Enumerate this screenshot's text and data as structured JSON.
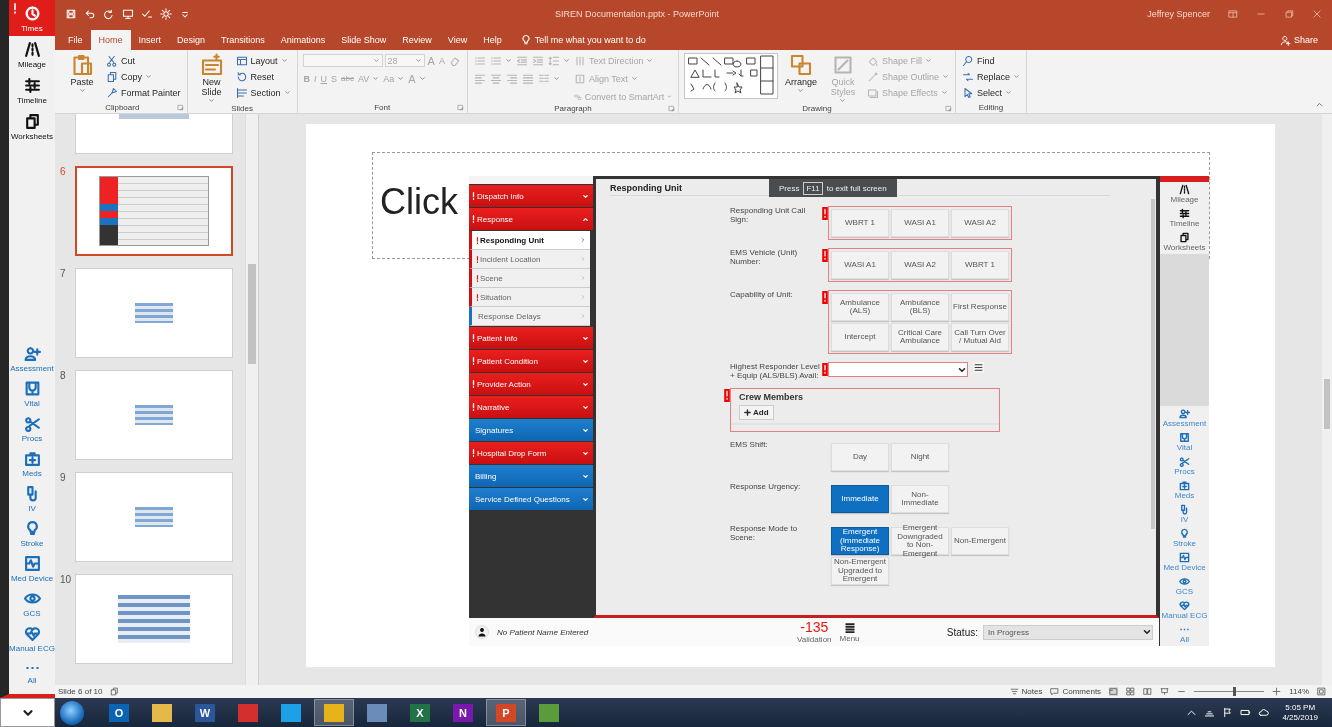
{
  "rail": {
    "top": [
      {
        "label": "Times",
        "kind": "clock",
        "selected": true,
        "alert": true
      },
      {
        "label": "Mileage",
        "kind": "road",
        "selected": false,
        "alert": false
      },
      {
        "label": "Timeline",
        "kind": "sliders",
        "selected": false,
        "alert": false
      },
      {
        "label": "Worksheets",
        "kind": "copy",
        "selected": false,
        "alert": false
      }
    ],
    "bottom": [
      {
        "label": "Assessment",
        "kind": "personadd"
      },
      {
        "label": "Vital",
        "kind": "stethoscope"
      },
      {
        "label": "Procs",
        "kind": "scissors"
      },
      {
        "label": "Meds",
        "kind": "medkit"
      },
      {
        "label": "IV",
        "kind": "iv"
      },
      {
        "label": "Stroke",
        "kind": "bulb"
      },
      {
        "label": "Med Device",
        "kind": "monitor"
      },
      {
        "label": "GCS",
        "kind": "eye"
      },
      {
        "label": "Manual ECG",
        "kind": "heart"
      },
      {
        "label": "All",
        "kind": "dots"
      }
    ]
  },
  "window": {
    "title": "SIREN Documentation.pptx  -  PowerPoint",
    "user": "Jeffrey Spencer",
    "share": "Share",
    "tell_me": "Tell me what you want to do"
  },
  "quick_access": [
    {
      "kind": "save"
    },
    {
      "kind": "undo"
    },
    {
      "kind": "redo"
    },
    {
      "kind": "present"
    },
    {
      "kind": "spell"
    },
    {
      "kind": "sun"
    },
    {
      "kind": "more"
    }
  ],
  "ribbon_tabs": [
    {
      "label": "File",
      "selected": false
    },
    {
      "label": "Home",
      "selected": true
    },
    {
      "label": "Insert",
      "selected": false
    },
    {
      "label": "Design",
      "selected": false
    },
    {
      "label": "Transitions",
      "selected": false
    },
    {
      "label": "Animations",
      "selected": false
    },
    {
      "label": "Slide Show",
      "selected": false
    },
    {
      "label": "Review",
      "selected": false
    },
    {
      "label": "View",
      "selected": false
    },
    {
      "label": "Help",
      "selected": false
    }
  ],
  "ribbon_groups": [
    {
      "label": "Clipboard",
      "dialog": true,
      "columns": [
        [
          {
            "kind": "paste",
            "label": "Paste",
            "dropdown": true,
            "disabled": false
          }
        ],
        [
          {
            "kind": "cut",
            "label": "Cut",
            "dropdown": false,
            "disabled": false
          },
          {
            "kind": "copy",
            "label": "Copy",
            "dropdown": true,
            "disabled": false
          },
          {
            "kind": "brush",
            "label": "Format Painter",
            "dropdown": false,
            "disabled": false
          }
        ]
      ]
    },
    {
      "label": "Slides",
      "dialog": false,
      "columns": [
        [
          {
            "kind": "newslide",
            "label": "New Slide",
            "dropdown": true,
            "disabled": false
          }
        ],
        [
          {
            "kind": "layout",
            "label": "Layout",
            "dropdown": true,
            "disabled": false
          },
          {
            "kind": "reset",
            "label": "Reset",
            "dropdown": false,
            "disabled": false
          },
          {
            "kind": "section",
            "label": "Section",
            "dropdown": true,
            "disabled": false
          }
        ]
      ]
    },
    {
      "label": "Font",
      "dialog": true,
      "lines": [
        [
          {
            "kind": "field",
            "disabled": true
          },
          {
            "kind": "field",
            "value": "28",
            "disabled": true
          },
          {
            "kind": "grow",
            "label": "A",
            "disabled": true
          },
          {
            "kind": "shrink",
            "label": "A",
            "disabled": true
          },
          {
            "kind": "eraser",
            "disabled": true
          }
        ],
        [
          {
            "kind": "bold",
            "label": "B",
            "disabled": true
          },
          {
            "kind": "italic",
            "label": "I",
            "disabled": true
          },
          {
            "kind": "underline",
            "label": "U",
            "disabled": true
          },
          {
            "kind": "shadow",
            "label": "S",
            "disabled": true
          },
          {
            "kind": "strike",
            "label": "abc",
            "disabled": true
          },
          {
            "kind": "spacing",
            "label": "AV",
            "dropdown": true,
            "disabled": true
          },
          {
            "kind": "case",
            "label": "Aa",
            "dropdown": true,
            "disabled": true
          },
          {
            "kind": "fontcolor",
            "label": "A",
            "dropdown": true,
            "disabled": true
          }
        ]
      ]
    },
    {
      "label": "Paragraph",
      "dialog": true,
      "lines": [
        [
          {
            "kind": "bullets",
            "disabled": true
          },
          {
            "kind": "numbering",
            "dropdown": true,
            "disabled": true
          },
          {
            "kind": "outdent",
            "disabled": true
          },
          {
            "kind": "indent",
            "disabled": true
          },
          {
            "kind": "linespacing",
            "dropdown": true,
            "disabled": true
          },
          {
            "kind": "textdir",
            "label": "Text Direction",
            "dropdown": true,
            "disabled": true
          }
        ],
        [
          {
            "kind": "alignleft",
            "disabled": true
          },
          {
            "kind": "aligncenter",
            "disabled": true
          },
          {
            "kind": "alignright",
            "disabled": true
          },
          {
            "kind": "justify",
            "disabled": true
          },
          {
            "kind": "columns",
            "dropdown": true,
            "disabled": true
          },
          {
            "kind": "aligntext",
            "label": "Align Text",
            "dropdown": true,
            "disabled": true
          }
        ],
        [
          {
            "kind": "smartart",
            "label": "Convert to SmartArt",
            "dropdown": true,
            "disabled": true
          }
        ]
      ]
    },
    {
      "label": "Drawing",
      "dialog": true,
      "columns": [
        [
          {
            "kind": "gallery",
            "disabled": false
          }
        ],
        [
          {
            "kind": "arrange",
            "label": "Arrange",
            "dropdown": true,
            "disabled": false
          }
        ],
        [
          {
            "kind": "quickstyles",
            "label": "Quick Styles",
            "dropdown": true,
            "disabled": true
          }
        ],
        [
          {
            "kind": "fill",
            "label": "Shape Fill",
            "dropdown": true,
            "disabled": true
          },
          {
            "kind": "outline",
            "label": "Shape Outline",
            "dropdown": true,
            "disabled": true
          },
          {
            "kind": "effects",
            "label": "Shape Effects",
            "dropdown": true,
            "disabled": true
          }
        ]
      ]
    },
    {
      "label": "Editing",
      "dialog": false,
      "columns": [
        [
          {
            "kind": "search",
            "label": "Find",
            "dropdown": false,
            "disabled": false
          },
          {
            "kind": "replace",
            "label": "Replace",
            "dropdown": true,
            "disabled": false
          },
          {
            "kind": "cursor",
            "label": "Select",
            "dropdown": true,
            "disabled": false
          }
        ]
      ]
    }
  ],
  "thumbnails": [
    {
      "kind": "small-image",
      "selected": false
    },
    {
      "number": "6",
      "kind": "app",
      "selected": true
    },
    {
      "number": "7",
      "kind": "table",
      "selected": false
    },
    {
      "number": "8",
      "kind": "table",
      "selected": false
    },
    {
      "number": "9",
      "kind": "table",
      "selected": false
    },
    {
      "number": "10",
      "kind": "large-table",
      "selected": false
    }
  ],
  "slide": {
    "placeholder": "Click",
    "siren": {
      "nav": [
        {
          "label": "Dispatch Info",
          "required": true,
          "expanded": false
        },
        {
          "label": "Response",
          "required": true,
          "expanded": true,
          "children": [
            {
              "label": "Responding Unit",
              "required": true,
              "selected": true
            },
            {
              "label": "Incident Location",
              "required": true,
              "selected": false
            },
            {
              "label": "Scene",
              "required": true,
              "selected": false
            },
            {
              "label": "Situation",
              "required": true,
              "selected": false
            },
            {
              "label": "Response Delays",
              "required": false,
              "selected": false
            }
          ]
        },
        {
          "label": "Patient Info",
          "required": true,
          "expanded": false
        },
        {
          "label": "Patient Condition",
          "required": true,
          "expanded": false
        },
        {
          "label": "Provider Action",
          "required": true,
          "expanded": false
        },
        {
          "label": "Narrative",
          "required": true,
          "expanded": false
        },
        {
          "label": "Signatures",
          "required": false,
          "expanded": false
        },
        {
          "label": "Hospital Drop Form",
          "required": true,
          "expanded": false
        },
        {
          "label": "Billing",
          "required": false,
          "expanded": false
        },
        {
          "label": "Service Defined Questions",
          "required": false,
          "expanded": false
        }
      ],
      "heading": "Responding Unit",
      "tooltip": {
        "before": "Press",
        "key": "F11",
        "after": "to exit full screen"
      },
      "fields": [
        {
          "kind": "choice",
          "label": "Responding Unit Call Sign:",
          "required": true,
          "options": [
            {
              "label": "WBRT 1",
              "selected": false
            },
            {
              "label": "WASI A1",
              "selected": false
            },
            {
              "label": "WASI A2",
              "selected": false
            }
          ]
        },
        {
          "kind": "choice",
          "label": "EMS Vehicle (Unit) Number:",
          "required": true,
          "options": [
            {
              "label": "WASI A1",
              "selected": false
            },
            {
              "label": "WASI A2",
              "selected": false
            },
            {
              "label": "WBRT 1",
              "selected": false
            }
          ]
        },
        {
          "kind": "choice",
          "label": "Capability of Unit:",
          "required": true,
          "options": [
            {
              "label": "Ambulance (ALS)",
              "selected": false
            },
            {
              "label": "Ambulance (BLS)",
              "selected": false
            },
            {
              "label": "First Response",
              "selected": false
            },
            {
              "label": "Intercept",
              "selected": false
            },
            {
              "label": "Critical Care Ambulance",
              "selected": false
            },
            {
              "label": "Call Turn Over / Mutual Aid",
              "selected": false
            }
          ]
        },
        {
          "kind": "select",
          "label": "Highest Responder Level + Equip (ALS/BLS) Avail:",
          "required": true
        },
        {
          "kind": "group",
          "title": "Crew Members",
          "button": "Add",
          "required": true
        },
        {
          "kind": "choice",
          "label": "EMS Shift:",
          "required": false,
          "options": [
            {
              "label": "Day",
              "selected": false
            },
            {
              "label": "Night",
              "selected": false
            }
          ]
        },
        {
          "kind": "choice",
          "label": "Response Urgency:",
          "required": false,
          "options": [
            {
              "label": "Immediate",
              "selected": true
            },
            {
              "label": "Non-Immediate",
              "selected": false
            }
          ]
        },
        {
          "kind": "choice",
          "label": "Response Mode to Scene:",
          "required": false,
          "options": [
            {
              "label": "Emergent (Immediate Response)",
              "selected": true
            },
            {
              "label": "Emergent Downgraded to Non-Emergent",
              "selected": false
            },
            {
              "label": "Non-Emergent",
              "selected": false
            },
            {
              "label": "Non-Emergent Upgraded to Emergent",
              "selected": false
            }
          ]
        }
      ],
      "rail": {
        "top": [
          {
            "label": "Mileage",
            "kind": "road"
          },
          {
            "label": "Timeline",
            "kind": "sliders"
          },
          {
            "label": "Worksheets",
            "kind": "copy"
          }
        ],
        "bottom": [
          {
            "label": "Assessment",
            "kind": "personadd"
          },
          {
            "label": "Vital",
            "kind": "stethoscope"
          },
          {
            "label": "Procs",
            "kind": "scissors"
          },
          {
            "label": "Meds",
            "kind": "medkit"
          },
          {
            "label": "IV",
            "kind": "iv"
          },
          {
            "label": "Stroke",
            "kind": "bulb"
          },
          {
            "label": "Med Device",
            "kind": "monitor"
          },
          {
            "label": "GCS",
            "kind": "eye"
          },
          {
            "label": "Manual ECG",
            "kind": "heart"
          },
          {
            "label": "All",
            "kind": "dots"
          }
        ]
      },
      "footer": {
        "patient": "No Patient Name Entered",
        "validation_count": "-135",
        "validation_label": "Validation",
        "menu_label": "Menu",
        "status_label": "Status:",
        "status_value": "In Progress"
      }
    }
  },
  "status_bar": {
    "slide_info": "Slide 6 of 10",
    "notes": "Notes",
    "comments": "Comments",
    "zoom": "114%",
    "level": 0.55
  },
  "taskbar": {
    "apps": [
      {
        "kind": "outlook",
        "letter": "O",
        "active": false
      },
      {
        "kind": "folder",
        "active": false
      },
      {
        "kind": "word",
        "letter": "W",
        "active": false
      },
      {
        "kind": "pdf",
        "active": false
      },
      {
        "kind": "ie",
        "active": false
      },
      {
        "kind": "chrome",
        "active": true
      },
      {
        "kind": "remote",
        "active": false
      },
      {
        "kind": "excel",
        "letter": "X",
        "active": false
      },
      {
        "kind": "onenote",
        "letter": "N",
        "active": false
      },
      {
        "kind": "powerpoint",
        "letter": "P",
        "active": true
      },
      {
        "kind": "tool",
        "active": false
      }
    ],
    "time": "5:05 PM",
    "date": "4/25/2019"
  }
}
